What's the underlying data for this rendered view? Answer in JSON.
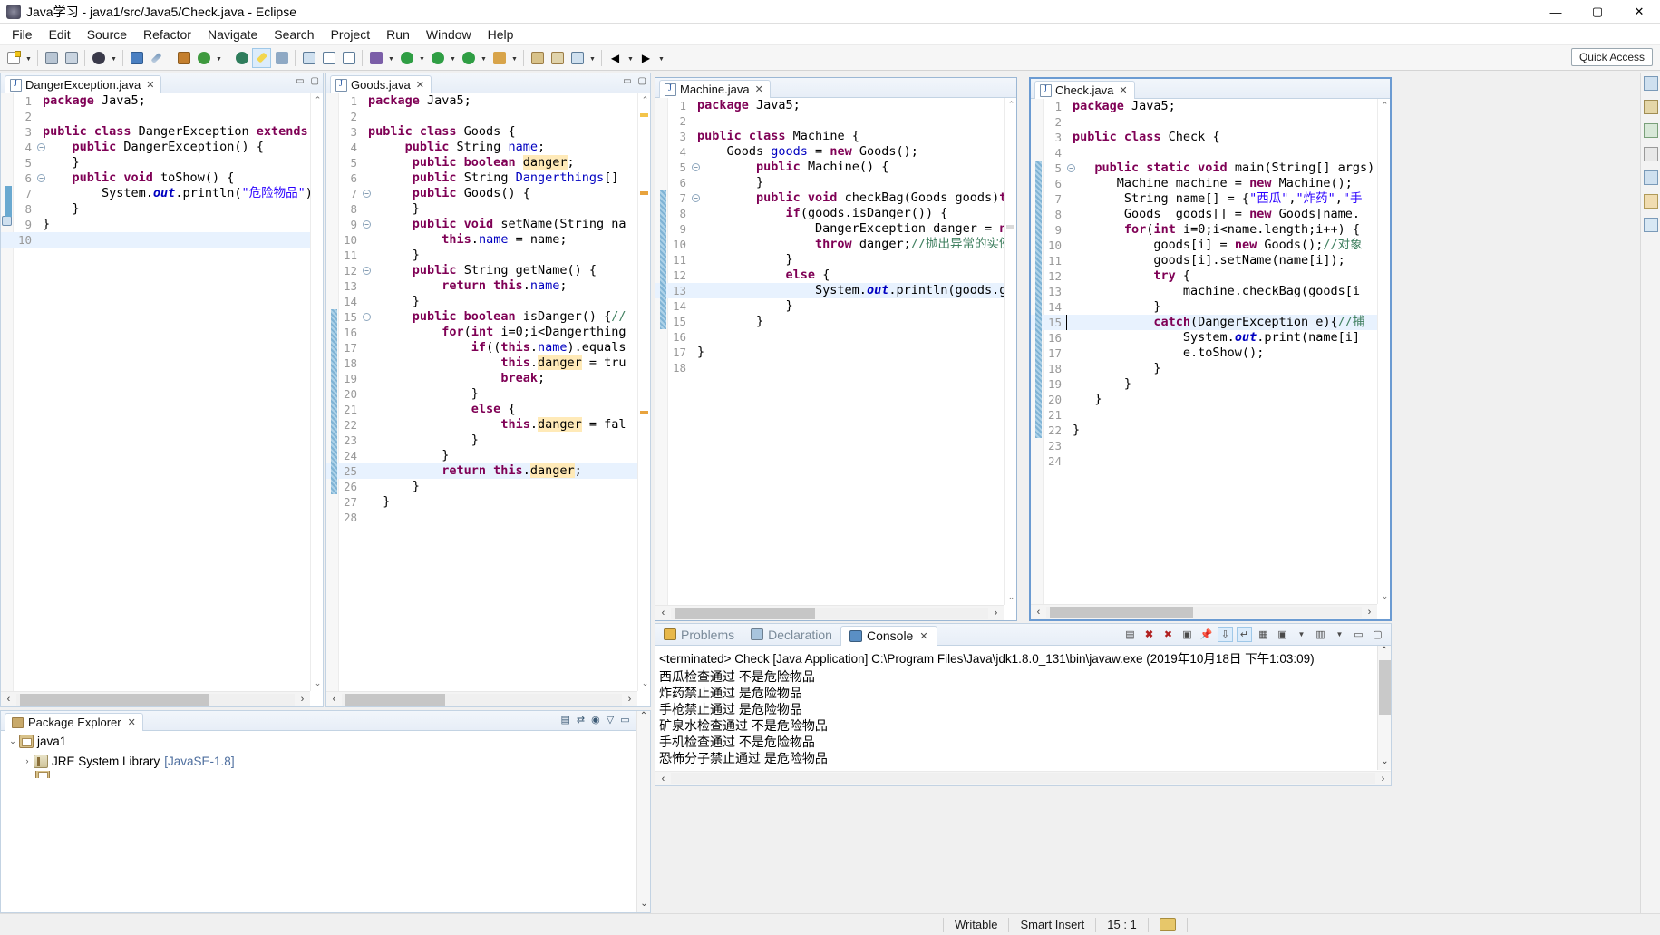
{
  "window": {
    "title": "Java学习 - java1/src/Java5/Check.java - Eclipse",
    "minimize": "—",
    "maximize": "▢",
    "close": "✕"
  },
  "menubar": [
    "File",
    "Edit",
    "Source",
    "Refactor",
    "Navigate",
    "Search",
    "Project",
    "Run",
    "Window",
    "Help"
  ],
  "toolbar": {
    "quick_access": "Quick Access"
  },
  "editors": [
    {
      "tab": "DangerException.java",
      "lines": [
        {
          "n": "1",
          "html": "<span class=\"kw\">package</span> Java5;"
        },
        {
          "n": "2",
          "html": ""
        },
        {
          "n": "3",
          "html": "<span class=\"kw\">public class</span> DangerException <span class=\"kw\">extends</span>"
        },
        {
          "n": "4",
          "fold": true,
          "html": "    <span class=\"kw\">public</span> DangerException() {"
        },
        {
          "n": "5",
          "html": "    }"
        },
        {
          "n": "6",
          "fold": true,
          "html": "    <span class=\"kw\">public void</span> toShow() {"
        },
        {
          "n": "7",
          "html": "        System.<span class=\"ital\">out</span>.println(<span class=\"str\">\"危险物品\"</span>)"
        },
        {
          "n": "8",
          "html": "    }"
        },
        {
          "n": "9",
          "html": "}"
        },
        {
          "n": "10",
          "hl": true,
          "html": ""
        }
      ]
    },
    {
      "tab": "Goods.java",
      "lines": [
        {
          "n": "1",
          "html": "<span class=\"kw\">package</span> Java5;"
        },
        {
          "n": "2",
          "html": ""
        },
        {
          "n": "3",
          "html": "<span class=\"kw\">public class</span> Goods {"
        },
        {
          "n": "4",
          "html": "     <span class=\"kw\">public</span> String <span class=\"fld\">name</span>;"
        },
        {
          "n": "5",
          "html": "      <span class=\"kw\">public boolean</span> <span class=\"hlv\">danger</span>;"
        },
        {
          "n": "6",
          "html": "      <span class=\"kw\">public</span> String <span class=\"fld\">Dangerthings</span>[]"
        },
        {
          "n": "7",
          "fold": true,
          "html": "      <span class=\"kw\">public</span> Goods() {"
        },
        {
          "n": "8",
          "html": "      }"
        },
        {
          "n": "9",
          "fold": true,
          "html": "      <span class=\"kw\">public void</span> setName(String na"
        },
        {
          "n": "10",
          "html": "          <span class=\"kw\">this</span>.<span class=\"fld\">name</span> = name;"
        },
        {
          "n": "11",
          "html": "      }"
        },
        {
          "n": "12",
          "fold": true,
          "html": "      <span class=\"kw\">public</span> String getName() {"
        },
        {
          "n": "13",
          "html": "          <span class=\"kw\">return this</span>.<span class=\"fld\">name</span>;"
        },
        {
          "n": "14",
          "html": "      }"
        },
        {
          "n": "15",
          "fold": true,
          "html": "      <span class=\"kw\">public boolean</span> isDanger() {<span class=\"cmt\">//</span>"
        },
        {
          "n": "16",
          "html": "          <span class=\"kw\">for</span>(<span class=\"kw\">int</span> i=0;i&lt;Dangerthing"
        },
        {
          "n": "17",
          "html": "              <span class=\"kw\">if</span>((<span class=\"kw\">this</span>.<span class=\"fld\">name</span>).equals"
        },
        {
          "n": "18",
          "html": "                  <span class=\"kw\">this</span>.<span class=\"hlv\">danger</span> = tru"
        },
        {
          "n": "19",
          "html": "                  <span class=\"kw\">break</span>;"
        },
        {
          "n": "20",
          "html": "              }"
        },
        {
          "n": "21",
          "html": "              <span class=\"kw\">else</span> {"
        },
        {
          "n": "22",
          "html": "                  <span class=\"kw\">this</span>.<span class=\"hlv\">danger</span> = fal"
        },
        {
          "n": "23",
          "html": "              }"
        },
        {
          "n": "24",
          "html": "          }"
        },
        {
          "n": "25",
          "hl": true,
          "html": "          <span class=\"kw\">return this</span>.<span class=\"hlv\">danger</span>;"
        },
        {
          "n": "26",
          "html": "      }"
        },
        {
          "n": "27",
          "html": "  }"
        },
        {
          "n": "28",
          "html": ""
        }
      ]
    },
    {
      "tab": "Machine.java",
      "lines": [
        {
          "n": "1",
          "html": "<span class=\"kw\">package</span> Java5;"
        },
        {
          "n": "2",
          "html": ""
        },
        {
          "n": "3",
          "html": "<span class=\"kw\">public class</span> Machine {"
        },
        {
          "n": "4",
          "html": "    Goods <span class=\"fld\">goods</span> = <span class=\"kw\">new</span> Goods();"
        },
        {
          "n": "5",
          "fold": true,
          "html": "        <span class=\"kw\">public</span> Machine() {"
        },
        {
          "n": "6",
          "html": "        }"
        },
        {
          "n": "7",
          "fold": true,
          "html": "        <span class=\"kw\">public void</span> checkBag(Goods goods)<span class=\"kw\">thr</span>"
        },
        {
          "n": "8",
          "html": "            <span class=\"kw\">if</span>(goods.isDanger()) {"
        },
        {
          "n": "9",
          "html": "                DangerException danger = <span class=\"kw\">new</span>"
        },
        {
          "n": "10",
          "html": "                <span class=\"kw\">throw</span> danger;<span class=\"cmt\">//抛出异常的实例</span>"
        },
        {
          "n": "11",
          "html": "            }"
        },
        {
          "n": "12",
          "html": "            <span class=\"kw\">else</span> {"
        },
        {
          "n": "13",
          "hl": true,
          "html": "                System.<span class=\"ital\">out</span>.println(goods.get"
        },
        {
          "n": "14",
          "html": "            }"
        },
        {
          "n": "15",
          "html": "        }"
        },
        {
          "n": "16",
          "html": ""
        },
        {
          "n": "17",
          "html": "}"
        },
        {
          "n": "18",
          "html": ""
        }
      ]
    },
    {
      "tab": "Check.java",
      "lines": [
        {
          "n": "1",
          "html": "<span class=\"kw\">package</span> Java5;"
        },
        {
          "n": "2",
          "html": ""
        },
        {
          "n": "3",
          "html": "<span class=\"kw\">public class</span> Check {"
        },
        {
          "n": "4",
          "html": ""
        },
        {
          "n": "5",
          "fold": true,
          "html": "   <span class=\"kw\">public static void</span> main(String[] args) {"
        },
        {
          "n": "6",
          "html": "      Machine machine = <span class=\"kw\">new</span> Machine();"
        },
        {
          "n": "7",
          "html": "       String name[] = {<span class=\"str\">\"西瓜\"</span>,<span class=\"str\">\"炸药\"</span>,<span class=\"str\">\"手</span>"
        },
        {
          "n": "8",
          "html": "       Goods  goods[] = <span class=\"kw\">new</span> Goods[name."
        },
        {
          "n": "9",
          "html": "       <span class=\"kw\">for</span>(<span class=\"kw\">int</span> i=0;i&lt;name.length;i++) {"
        },
        {
          "n": "10",
          "html": "           goods[i] = <span class=\"kw\">new</span> Goods();<span class=\"cmt\">//对象</span>"
        },
        {
          "n": "11",
          "html": "           goods[i].setName(name[i]);"
        },
        {
          "n": "12",
          "html": "           <span class=\"kw\">try</span> {"
        },
        {
          "n": "13",
          "html": "               machine.checkBag(goods[i"
        },
        {
          "n": "14",
          "html": "           }"
        },
        {
          "n": "15",
          "hl": true,
          "caret": true,
          "html": "           <span class=\"kw\">catch</span>(DangerException e){<span class=\"cmt\">//捕</span>"
        },
        {
          "n": "16",
          "html": "               System.<span class=\"ital\">out</span>.print(name[i]"
        },
        {
          "n": "17",
          "html": "               e.toShow();"
        },
        {
          "n": "18",
          "html": "           }"
        },
        {
          "n": "19",
          "html": "       }"
        },
        {
          "n": "20",
          "html": "   }"
        },
        {
          "n": "21",
          "html": ""
        },
        {
          "n": "22",
          "html": "}"
        },
        {
          "n": "23",
          "html": ""
        },
        {
          "n": "24",
          "html": ""
        }
      ]
    }
  ],
  "package_explorer": {
    "tab": "Package Explorer",
    "tree": [
      {
        "indent": 0,
        "twisty": "⌄",
        "icon": "project",
        "label": "java1",
        "sub": ""
      },
      {
        "indent": 1,
        "twisty": "›",
        "icon": "library",
        "label": "JRE System Library",
        "sub": "[JavaSE-1.8]"
      }
    ]
  },
  "console": {
    "tabs": [
      {
        "label": "Problems",
        "active": false
      },
      {
        "label": "Declaration",
        "active": false
      },
      {
        "label": "Console",
        "active": true
      }
    ],
    "header": "<terminated> Check [Java Application] C:\\Program Files\\Java\\jdk1.8.0_131\\bin\\javaw.exe (2019年10月18日 下午1:03:09)",
    "output": [
      "西瓜检查通过  不是危险物品",
      "炸药禁止通过 是危险物品",
      "手枪禁止通过 是危险物品",
      "矿泉水检查通过  不是危险物品",
      "手机检查通过  不是危险物品",
      "恐怖分子禁止通过 是危险物品"
    ]
  },
  "statusbar": {
    "writable": "Writable",
    "insert_mode": "Smart Insert",
    "position": "15 : 1"
  }
}
